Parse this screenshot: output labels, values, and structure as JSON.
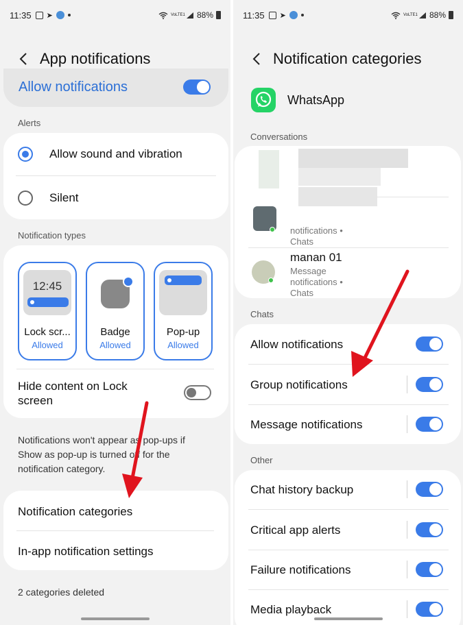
{
  "status_bar": {
    "time": "11:35",
    "battery": "88%",
    "lte_label": "VoLTE1"
  },
  "left": {
    "title": "App notifications",
    "allow_notifications": {
      "label": "Allow notifications",
      "enabled": true
    },
    "alerts": {
      "label": "Alerts",
      "options": [
        {
          "label": "Allow sound and vibration",
          "selected": true
        },
        {
          "label": "Silent",
          "selected": false
        }
      ]
    },
    "notification_types": {
      "label": "Notification types",
      "items": [
        {
          "label": "Lock scr...",
          "status": "Allowed",
          "preview_time": "12:45"
        },
        {
          "label": "Badge",
          "status": "Allowed"
        },
        {
          "label": "Pop-up",
          "status": "Allowed"
        }
      ]
    },
    "hide_content": {
      "line1": "Hide content on Lock",
      "line2": "screen",
      "enabled": false
    },
    "note": "Notifications won't appear as pop-ups if Show as pop-up is turned off for the notification category.",
    "links": [
      {
        "label": "Notification categories"
      },
      {
        "label": "In-app notification settings"
      }
    ],
    "footer": "2 categories deleted"
  },
  "right": {
    "title": "Notification categories",
    "app_name": "WhatsApp",
    "conversations": {
      "label": "Conversations",
      "items": [
        {
          "name": "",
          "subtitle": "notifications •",
          "sub2": "Chats"
        },
        {
          "name": "manan 01",
          "subtitle": "Message",
          "sub2": "notifications •",
          "sub3": "Chats"
        }
      ]
    },
    "chats": {
      "label": "Chats",
      "items": [
        {
          "label": "Allow notifications",
          "enabled": true
        },
        {
          "label": "Group notifications",
          "enabled": true
        },
        {
          "label": "Message notifications",
          "enabled": true
        }
      ]
    },
    "other": {
      "label": "Other",
      "items": [
        {
          "label": "Chat history backup",
          "enabled": true
        },
        {
          "label": "Critical app alerts",
          "enabled": true
        },
        {
          "label": "Failure notifications",
          "enabled": true
        },
        {
          "label": "Media playback",
          "enabled": true
        }
      ]
    }
  },
  "colors": {
    "accent": "#3a7be8",
    "arrow": "#e0141e",
    "whatsapp": "#25d366",
    "background": "#f2f2f2"
  }
}
